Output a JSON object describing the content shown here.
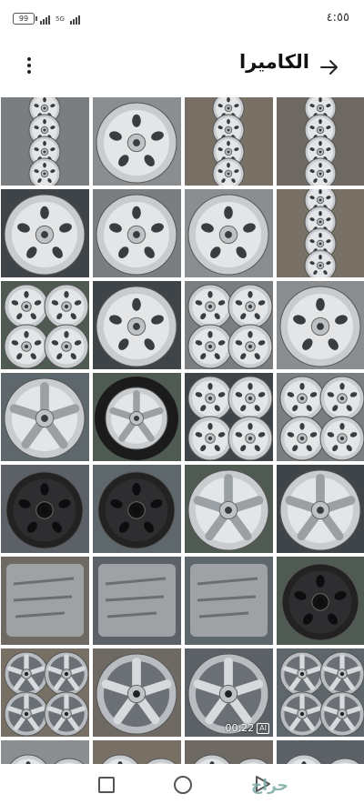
{
  "status": {
    "battery_level": "99",
    "network": "5G",
    "time": "٤:٥٥"
  },
  "header": {
    "title": "الكاميرا",
    "back_icon": "arrow-right-icon",
    "menu_icon": "more-vert-icon"
  },
  "grid": {
    "columns": 4,
    "cells": [
      {
        "label": "photo-stack-silver-wheels"
      },
      {
        "label": "photo-silver-steel-wheel"
      },
      {
        "label": "photo-stack-silver-wheels"
      },
      {
        "label": "photo-stack-silver-wheels"
      },
      {
        "label": "photo-silver-steel-wheel"
      },
      {
        "label": "photo-silver-steel-wheel"
      },
      {
        "label": "photo-silver-steel-wheel"
      },
      {
        "label": "photo-stack-silver-wheels"
      },
      {
        "label": "photo-silver-steel-wheels"
      },
      {
        "label": "photo-silver-steel-wheel"
      },
      {
        "label": "photo-silver-steel-wheels"
      },
      {
        "label": "photo-silver-steel-wheel"
      },
      {
        "label": "photo-alloy-wheel"
      },
      {
        "label": "photo-alloy-wheel-tire"
      },
      {
        "label": "photo-silver-steel-wheels"
      },
      {
        "label": "photo-silver-steel-wheels"
      },
      {
        "label": "photo-black-steel-wheel"
      },
      {
        "label": "photo-black-steel-wheel"
      },
      {
        "label": "photo-alloy-wheel"
      },
      {
        "label": "photo-alloy-wheel"
      },
      {
        "label": "photo-wheel-stamp"
      },
      {
        "label": "photo-wheel-stamp"
      },
      {
        "label": "photo-wheel-stamp"
      },
      {
        "label": "photo-black-steel-wheel"
      },
      {
        "label": "photo-chrome-wheels"
      },
      {
        "label": "photo-chrome-wheel"
      },
      {
        "label": "photo-chrome-wheel-video"
      },
      {
        "label": "photo-chrome-wheels"
      },
      {
        "label": "photo-wheels-partial"
      },
      {
        "label": "photo-wheels-partial"
      },
      {
        "label": "photo-wheels-partial"
      },
      {
        "label": "photo-wheels-partial"
      }
    ],
    "video": {
      "duration": "00:22",
      "badge": "AI"
    }
  },
  "navbar": {
    "recents_icon": "square-icon",
    "home_icon": "circle-icon",
    "back_icon": "triangle-back-icon"
  },
  "watermark": {
    "text": "حراج"
  },
  "colors": {
    "background": "#ffffff",
    "text": "#111111",
    "watermark": "#7aa9a4"
  }
}
